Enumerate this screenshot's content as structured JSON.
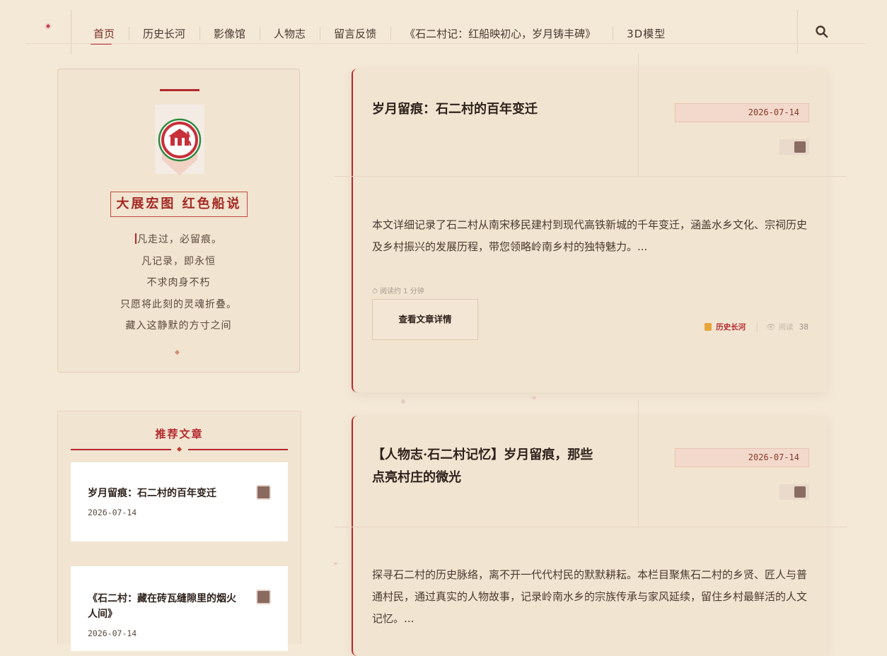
{
  "nav": {
    "items": [
      {
        "label": "首页",
        "active": true
      },
      {
        "label": "历史长河"
      },
      {
        "label": "影像馆"
      },
      {
        "label": "人物志"
      },
      {
        "label": "留言反馈"
      },
      {
        "label": "《石二村记：红船映初心，岁月铸丰碑》"
      },
      {
        "label": "3D模型"
      }
    ],
    "search_icon": "search-icon"
  },
  "profile": {
    "brand": "大展宏图 红色船说",
    "poem": [
      "凡走过，必留痕。",
      "凡记录，即永恒",
      "不求肉身不朽",
      "只愿将此刻的灵魂折叠。",
      "藏入这静默的方寸之间"
    ]
  },
  "recommended": {
    "title": "推荐文章",
    "items": [
      {
        "title": "岁月留痕：石二村的百年变迁",
        "date": "2026-07-14"
      },
      {
        "title": "《石二村：藏在砖瓦缝隙里的烟火人间》",
        "date": "2026-07-14"
      }
    ]
  },
  "articles": [
    {
      "title": "岁月留痕：石二村的百年变迁",
      "date": "2026-07-14",
      "excerpt": "本文详细记录了石二村从南宋移民建村到现代高铁新城的千年变迁，涵盖水乡文化、宗祠历史及乡村振兴的发展历程，带您领略岭南乡村的独特魅力。...",
      "read_time": "⏱ 阅读约 1 分钟",
      "button": "查看文章详情",
      "category": "历史长河",
      "views_label": "阅读",
      "views": "38"
    },
    {
      "title": "【人物志·石二村记忆】岁月留痕，那些点亮村庄的微光",
      "date": "2026-07-14",
      "excerpt": "探寻石二村的历史脉络，离不开一代代村民的默默耕耘。本栏目聚焦石二村的乡贤、匠人与普通村民，通过真实的人物故事，记录岭南水乡的宗族传承与家风延续，留住乡村最鲜活的人文记忆。..."
    }
  ],
  "colors": {
    "accent": "#b3282d",
    "background": "#f4e8d7",
    "card": "#f1e4d1"
  }
}
